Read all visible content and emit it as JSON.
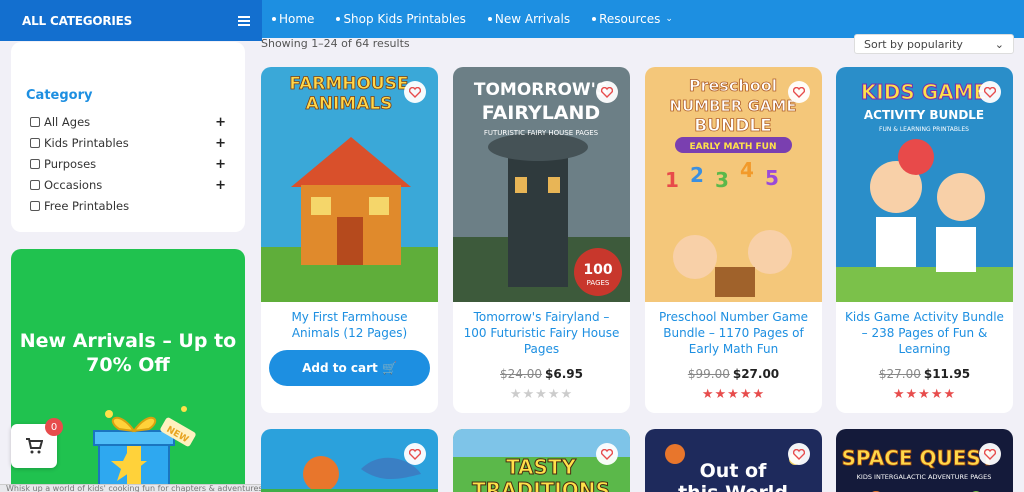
{
  "nav": {
    "all_categories": "ALL CATEGORIES",
    "items": [
      {
        "label": "Home"
      },
      {
        "label": "Shop Kids Printables"
      },
      {
        "label": "New Arrivals"
      },
      {
        "label": "Resources"
      }
    ]
  },
  "results": {
    "showing": "Showing 1–24 of 64 results"
  },
  "sort": {
    "selected": "Sort by popularity"
  },
  "sidebar": {
    "title": "Category",
    "items": [
      {
        "label": "All Ages",
        "expandable": true
      },
      {
        "label": "Kids Printables",
        "expandable": true
      },
      {
        "label": "Purposes",
        "expandable": true
      },
      {
        "label": "Occasions",
        "expandable": true
      },
      {
        "label": "Free Printables",
        "expandable": false
      }
    ],
    "plus": "+"
  },
  "promo": {
    "text": "New Arrivals – Up to 70% Off",
    "badge": "NEW"
  },
  "cart": {
    "count": "0"
  },
  "statusbar": {
    "text": "Whisk up a world of kids' cooking fun for chapters & adventures"
  },
  "products": [
    {
      "title": "My First Farmhouse Animals (12 Pages)",
      "cover_title": "FARMHOUSE ANIMALS",
      "add_to_cart": "Add to cart",
      "bg": "#3aa8d8"
    },
    {
      "title": "Tomorrow's Fairyland – 100 Futuristic Fairy House Pages",
      "cover_title": "TOMORROW'S FAIRYLAND",
      "cover_sub": "FUTURISTIC FAIRY HOUSE PAGES",
      "cover_badge": "100",
      "cover_badge_sub": "PAGES",
      "old_price": "$24.00",
      "price": "$6.95",
      "rating": 0,
      "bg": "#6c7f86"
    },
    {
      "title": "Preschool Number Game Bundle – 1170 Pages of Early Math Fun",
      "cover_title": "Preschool NUMBER GAME BUNDLE",
      "cover_sub": "EARLY MATH FUN",
      "old_price": "$99.00",
      "price": "$27.00",
      "rating": 5,
      "bg": "#f4c77a"
    },
    {
      "title": "Kids Game Activity Bundle – 238 Pages of Fun & Learning",
      "cover_title": "KIDS GAME ACTIVITY BUNDLE",
      "cover_sub": "FUN & LEARNING PRINTABLES",
      "old_price": "$27.00",
      "price": "$11.95",
      "rating": 5,
      "bg": "#2a8ec9"
    }
  ],
  "products_row2": [
    {
      "cover_title": "",
      "bg": "#2ba1dc"
    },
    {
      "cover_title": "TASTY TRADITIONS",
      "bg": "#5bb84a"
    },
    {
      "cover_title": "Out of this World",
      "bg": "#1e2a5c"
    },
    {
      "cover_title": "SPACE QUEST",
      "cover_sub": "KIDS INTERGALACTIC ADVENTURE PAGES",
      "bg": "#141a3a"
    }
  ],
  "colors": {
    "accent": "#1d8fe1",
    "star": "#e74c4c",
    "promo": "#20c24f"
  }
}
